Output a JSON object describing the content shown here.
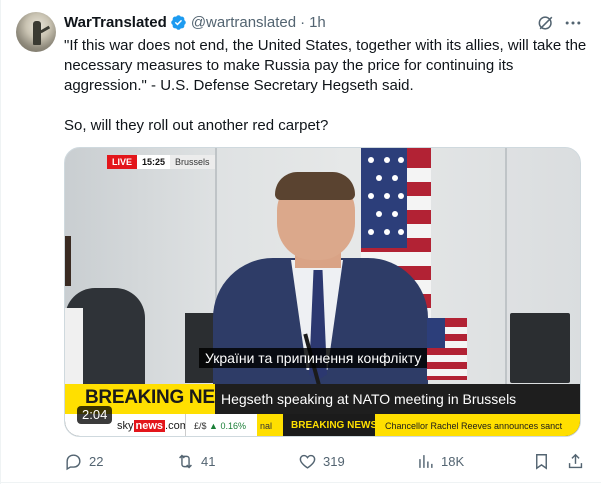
{
  "tweet": {
    "author_name": "WarTranslated",
    "handle": "@wartranslated",
    "separator": "·",
    "time": "1h",
    "text_line1": "\"If this war does not end, the United States, together with its allies, will take the necessary measures to make Russia pay the price for continuing its aggression.\" - U.S. Defense Secretary Hegseth said.",
    "text_line2": "So, will they roll out another red carpet?"
  },
  "media": {
    "live_label": "LIVE",
    "clock": "15:25",
    "location": "Brussels",
    "subtitle": "України та припинення конфлікту",
    "breaking_label": "BREAKING NEWS",
    "headline": "Hegseth speaking at NATO meeting in Brussels",
    "ticker_site_prefix": "sky",
    "ticker_site_news": "news",
    "ticker_site_suffix": ".com",
    "ticker_fx_pair": "£/$",
    "ticker_fx_change": "▲ 0.16%",
    "ticker_partial": "nal",
    "ticker_breaking": "BREAKING NEWS",
    "ticker_story": "Chancellor Rachel Reeves announces sanct",
    "duration": "2:04"
  },
  "actions": {
    "replies": "22",
    "reposts": "41",
    "likes": "319",
    "views": "18K"
  },
  "colors": {
    "verified_blue": "#1d9bf0",
    "muted_text": "#536471",
    "sky_red": "#e3161b",
    "sky_yellow": "#ffdf00"
  }
}
